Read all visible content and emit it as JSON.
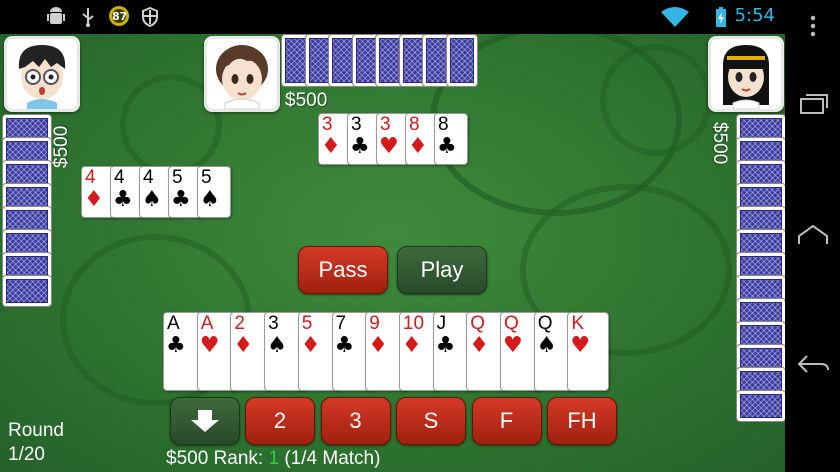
{
  "status_bar": {
    "time": "5:54",
    "notification_badge": "87",
    "icons": [
      "android-debug-icon",
      "usb-icon",
      "badge-icon",
      "shield-icon",
      "wifi-icon",
      "battery-charging-icon"
    ]
  },
  "players": {
    "left": {
      "money": "$500"
    },
    "top": {
      "money": "$500"
    },
    "right": {
      "money": "$500"
    }
  },
  "center_pile": [
    {
      "rank": "3",
      "suit": "♦",
      "color": "red"
    },
    {
      "rank": "3",
      "suit": "♣",
      "color": "black"
    },
    {
      "rank": "3",
      "suit": "♥",
      "color": "red"
    },
    {
      "rank": "8",
      "suit": "♦",
      "color": "red"
    },
    {
      "rank": "8",
      "suit": "♣",
      "color": "black"
    }
  ],
  "left_played": [
    {
      "rank": "4",
      "suit": "♦",
      "color": "red"
    },
    {
      "rank": "4",
      "suit": "♣",
      "color": "black"
    },
    {
      "rank": "4",
      "suit": "♠",
      "color": "black"
    },
    {
      "rank": "5",
      "suit": "♣",
      "color": "black"
    },
    {
      "rank": "5",
      "suit": "♠",
      "color": "black"
    }
  ],
  "actions": {
    "pass": "Pass",
    "play": "Play"
  },
  "hand": [
    {
      "rank": "A",
      "suit": "♣",
      "color": "black"
    },
    {
      "rank": "A",
      "suit": "♥",
      "color": "red"
    },
    {
      "rank": "2",
      "suit": "♦",
      "color": "red"
    },
    {
      "rank": "3",
      "suit": "♠",
      "color": "black"
    },
    {
      "rank": "5",
      "suit": "♦",
      "color": "red"
    },
    {
      "rank": "7",
      "suit": "♣",
      "color": "black"
    },
    {
      "rank": "9",
      "suit": "♦",
      "color": "red"
    },
    {
      "rank": "10",
      "suit": "♦",
      "color": "red"
    },
    {
      "rank": "J",
      "suit": "♣",
      "color": "black"
    },
    {
      "rank": "Q",
      "suit": "♦",
      "color": "red"
    },
    {
      "rank": "Q",
      "suit": "♥",
      "color": "red"
    },
    {
      "rank": "Q",
      "suit": "♠",
      "color": "black"
    },
    {
      "rank": "K",
      "suit": "♥",
      "color": "red"
    }
  ],
  "combo_buttons": [
    "2",
    "3",
    "S",
    "F",
    "FH"
  ],
  "round": {
    "label": "Round",
    "value": "1/20"
  },
  "footer": {
    "money": "$500",
    "rank_label": "Rank:",
    "rank_value": "1",
    "match": "(1/4 Match)"
  },
  "colors": {
    "felt": "#2f7530",
    "button_red": "#b52a16",
    "button_green": "#32563a",
    "card_back": "#3b3ba3",
    "rank_highlight": "#2ecc40"
  }
}
